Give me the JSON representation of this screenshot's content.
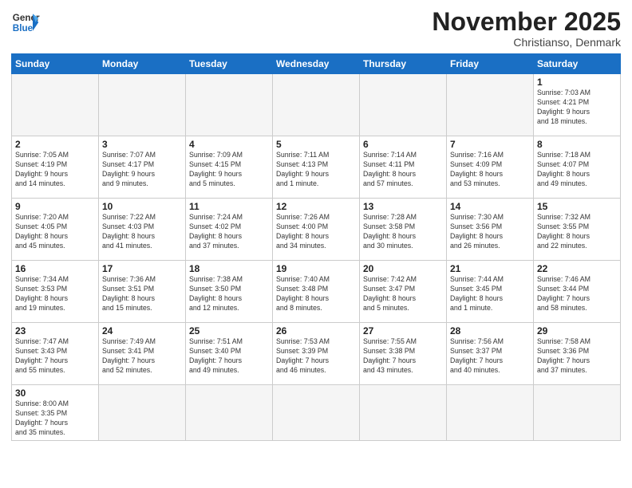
{
  "header": {
    "logo_general": "General",
    "logo_blue": "Blue",
    "month_title": "November 2025",
    "subtitle": "Christianso, Denmark"
  },
  "weekdays": [
    "Sunday",
    "Monday",
    "Tuesday",
    "Wednesday",
    "Thursday",
    "Friday",
    "Saturday"
  ],
  "weeks": [
    [
      {
        "day": "",
        "info": ""
      },
      {
        "day": "",
        "info": ""
      },
      {
        "day": "",
        "info": ""
      },
      {
        "day": "",
        "info": ""
      },
      {
        "day": "",
        "info": ""
      },
      {
        "day": "",
        "info": ""
      },
      {
        "day": "1",
        "info": "Sunrise: 7:03 AM\nSunset: 4:21 PM\nDaylight: 9 hours\nand 18 minutes."
      }
    ],
    [
      {
        "day": "2",
        "info": "Sunrise: 7:05 AM\nSunset: 4:19 PM\nDaylight: 9 hours\nand 14 minutes."
      },
      {
        "day": "3",
        "info": "Sunrise: 7:07 AM\nSunset: 4:17 PM\nDaylight: 9 hours\nand 9 minutes."
      },
      {
        "day": "4",
        "info": "Sunrise: 7:09 AM\nSunset: 4:15 PM\nDaylight: 9 hours\nand 5 minutes."
      },
      {
        "day": "5",
        "info": "Sunrise: 7:11 AM\nSunset: 4:13 PM\nDaylight: 9 hours\nand 1 minute."
      },
      {
        "day": "6",
        "info": "Sunrise: 7:14 AM\nSunset: 4:11 PM\nDaylight: 8 hours\nand 57 minutes."
      },
      {
        "day": "7",
        "info": "Sunrise: 7:16 AM\nSunset: 4:09 PM\nDaylight: 8 hours\nand 53 minutes."
      },
      {
        "day": "8",
        "info": "Sunrise: 7:18 AM\nSunset: 4:07 PM\nDaylight: 8 hours\nand 49 minutes."
      }
    ],
    [
      {
        "day": "9",
        "info": "Sunrise: 7:20 AM\nSunset: 4:05 PM\nDaylight: 8 hours\nand 45 minutes."
      },
      {
        "day": "10",
        "info": "Sunrise: 7:22 AM\nSunset: 4:03 PM\nDaylight: 8 hours\nand 41 minutes."
      },
      {
        "day": "11",
        "info": "Sunrise: 7:24 AM\nSunset: 4:02 PM\nDaylight: 8 hours\nand 37 minutes."
      },
      {
        "day": "12",
        "info": "Sunrise: 7:26 AM\nSunset: 4:00 PM\nDaylight: 8 hours\nand 34 minutes."
      },
      {
        "day": "13",
        "info": "Sunrise: 7:28 AM\nSunset: 3:58 PM\nDaylight: 8 hours\nand 30 minutes."
      },
      {
        "day": "14",
        "info": "Sunrise: 7:30 AM\nSunset: 3:56 PM\nDaylight: 8 hours\nand 26 minutes."
      },
      {
        "day": "15",
        "info": "Sunrise: 7:32 AM\nSunset: 3:55 PM\nDaylight: 8 hours\nand 22 minutes."
      }
    ],
    [
      {
        "day": "16",
        "info": "Sunrise: 7:34 AM\nSunset: 3:53 PM\nDaylight: 8 hours\nand 19 minutes."
      },
      {
        "day": "17",
        "info": "Sunrise: 7:36 AM\nSunset: 3:51 PM\nDaylight: 8 hours\nand 15 minutes."
      },
      {
        "day": "18",
        "info": "Sunrise: 7:38 AM\nSunset: 3:50 PM\nDaylight: 8 hours\nand 12 minutes."
      },
      {
        "day": "19",
        "info": "Sunrise: 7:40 AM\nSunset: 3:48 PM\nDaylight: 8 hours\nand 8 minutes."
      },
      {
        "day": "20",
        "info": "Sunrise: 7:42 AM\nSunset: 3:47 PM\nDaylight: 8 hours\nand 5 minutes."
      },
      {
        "day": "21",
        "info": "Sunrise: 7:44 AM\nSunset: 3:45 PM\nDaylight: 8 hours\nand 1 minute."
      },
      {
        "day": "22",
        "info": "Sunrise: 7:46 AM\nSunset: 3:44 PM\nDaylight: 7 hours\nand 58 minutes."
      }
    ],
    [
      {
        "day": "23",
        "info": "Sunrise: 7:47 AM\nSunset: 3:43 PM\nDaylight: 7 hours\nand 55 minutes."
      },
      {
        "day": "24",
        "info": "Sunrise: 7:49 AM\nSunset: 3:41 PM\nDaylight: 7 hours\nand 52 minutes."
      },
      {
        "day": "25",
        "info": "Sunrise: 7:51 AM\nSunset: 3:40 PM\nDaylight: 7 hours\nand 49 minutes."
      },
      {
        "day": "26",
        "info": "Sunrise: 7:53 AM\nSunset: 3:39 PM\nDaylight: 7 hours\nand 46 minutes."
      },
      {
        "day": "27",
        "info": "Sunrise: 7:55 AM\nSunset: 3:38 PM\nDaylight: 7 hours\nand 43 minutes."
      },
      {
        "day": "28",
        "info": "Sunrise: 7:56 AM\nSunset: 3:37 PM\nDaylight: 7 hours\nand 40 minutes."
      },
      {
        "day": "29",
        "info": "Sunrise: 7:58 AM\nSunset: 3:36 PM\nDaylight: 7 hours\nand 37 minutes."
      }
    ],
    [
      {
        "day": "30",
        "info": "Sunrise: 8:00 AM\nSunset: 3:35 PM\nDaylight: 7 hours\nand 35 minutes."
      },
      {
        "day": "",
        "info": ""
      },
      {
        "day": "",
        "info": ""
      },
      {
        "day": "",
        "info": ""
      },
      {
        "day": "",
        "info": ""
      },
      {
        "day": "",
        "info": ""
      },
      {
        "day": "",
        "info": ""
      }
    ]
  ]
}
